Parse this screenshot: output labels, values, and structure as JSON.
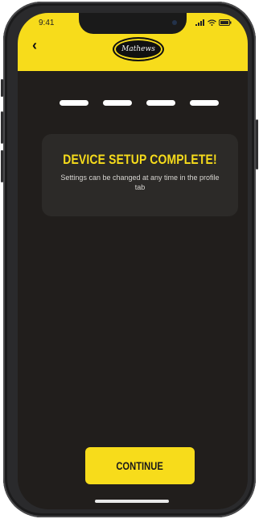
{
  "status_bar": {
    "time": "9:41"
  },
  "header": {
    "brand": "Mathews",
    "back_label": "‹"
  },
  "progress": {
    "steps_total": 4,
    "steps_complete": 4
  },
  "card": {
    "title": "DEVICE SETUP COMPLETE!",
    "description": "Settings can be changed at any time in the profile tab"
  },
  "footer": {
    "continue_label": "CONTINUE"
  },
  "colors": {
    "accent": "#f7dc1b",
    "background": "#211e1c",
    "card": "#2c2a28"
  },
  "icons": [
    "back-arrow-icon",
    "signal-icon",
    "wifi-icon",
    "battery-icon",
    "brand-logo"
  ]
}
